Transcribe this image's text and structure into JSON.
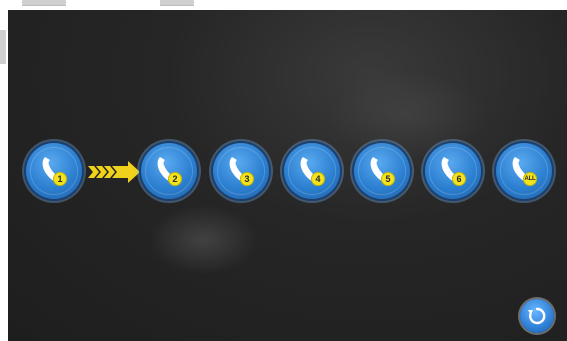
{
  "colors": {
    "background": "#1e1e1e",
    "button_blue": "#2b7fd0",
    "badge_yellow": "#f2e21f",
    "arrow_yellow": "#f0d21b"
  },
  "call_buttons": [
    {
      "label": "1",
      "icon": "phone-icon"
    },
    {
      "label": "2",
      "icon": "phone-icon"
    },
    {
      "label": "3",
      "icon": "phone-icon"
    },
    {
      "label": "4",
      "icon": "phone-icon"
    },
    {
      "label": "5",
      "icon": "phone-icon"
    },
    {
      "label": "6",
      "icon": "phone-icon"
    },
    {
      "label": "ALL",
      "icon": "phone-icon"
    }
  ],
  "indicator": {
    "icon": "chevron-right-arrow-icon"
  },
  "back_button": {
    "icon": "back-rotate-icon"
  }
}
